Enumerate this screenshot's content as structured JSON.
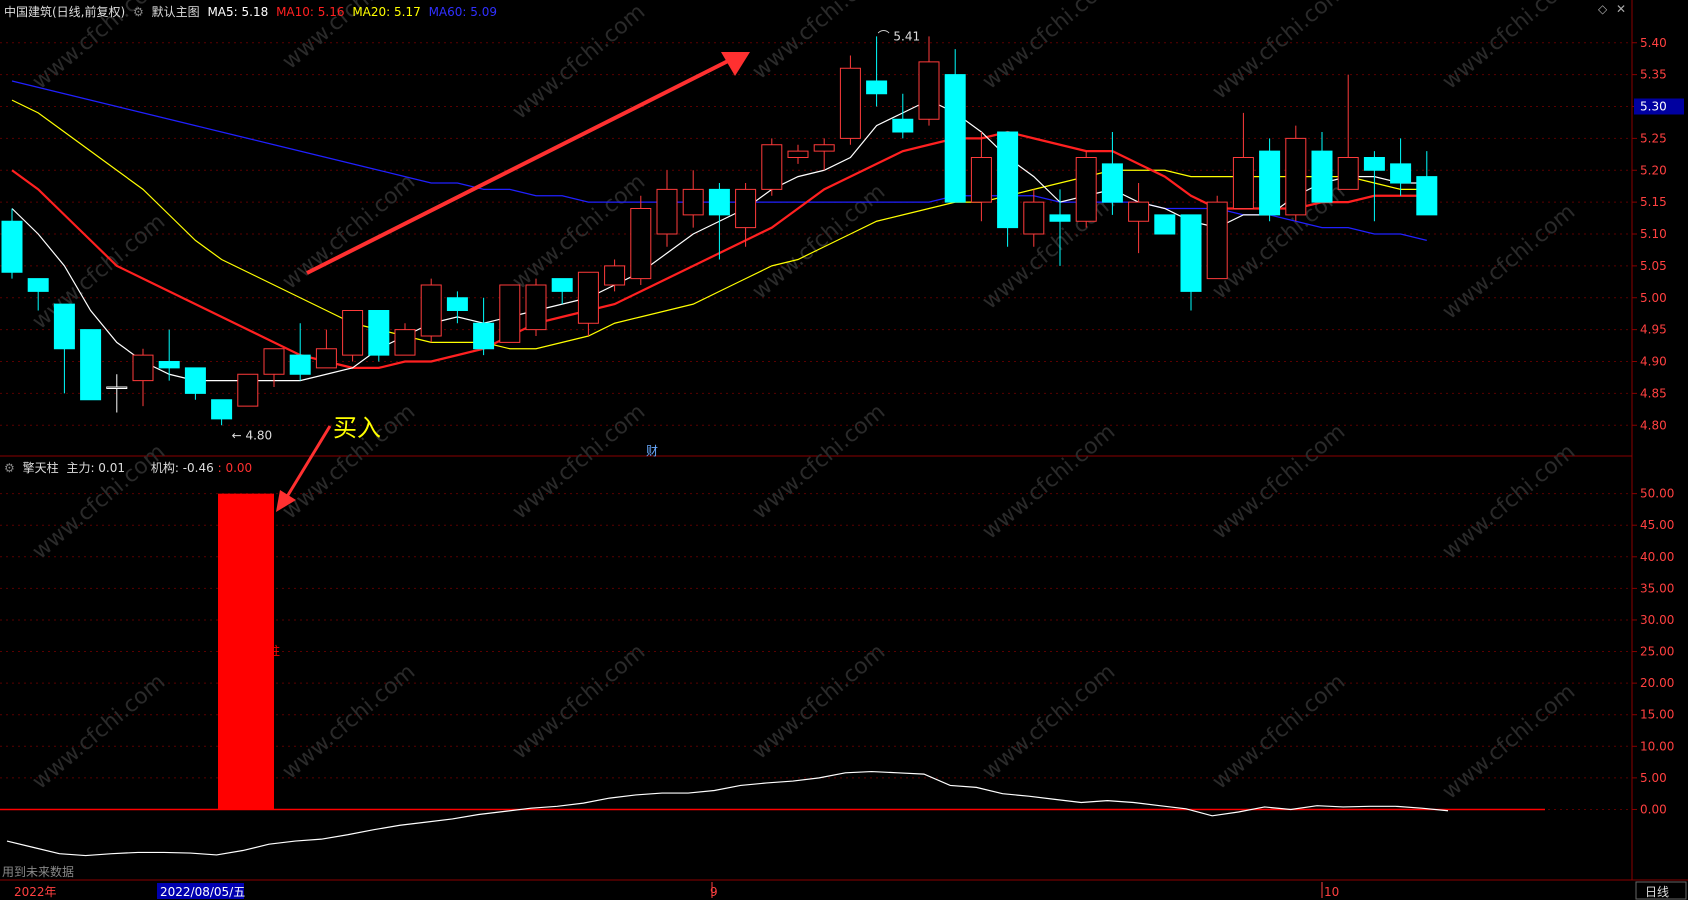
{
  "header": {
    "stock": "中国建筑(日线,前复权)",
    "template": "默认主图",
    "ma5": "MA5: 5.18",
    "ma10": "MA10: 5.16",
    "ma20": "MA20: 5.17",
    "ma60": "MA60: 5.09"
  },
  "indicator_header": {
    "name": "擎天柱",
    "main": "主力: 0.01",
    "inst": "机构: -0.46",
    "val": ": 0.00"
  },
  "toolbar": {
    "diamond": "◇",
    "x": "✕"
  },
  "annotations": {
    "buy": "买入",
    "high": "5.41",
    "low": "4.80",
    "cai": "财",
    "future": "用到未来数据",
    "pillar": "柱"
  },
  "watermark": "www.cfchi.com",
  "timeline": {
    "year": "2022年",
    "cursor_date": "2022/08/05/五",
    "m9": "9",
    "m10": "10",
    "period": "日线"
  },
  "price_axis": {
    "ticks": [
      "5.40",
      "5.35",
      "5.30",
      "5.25",
      "5.20",
      "5.15",
      "5.10",
      "5.05",
      "5.00",
      "4.95",
      "4.90",
      "4.85",
      "4.80"
    ],
    "current": "5.30"
  },
  "ind_axis": {
    "ticks": [
      "50.00",
      "45.00",
      "40.00",
      "35.00",
      "30.00",
      "25.00",
      "20.00",
      "15.00",
      "10.00",
      "5.00",
      "0.00"
    ]
  },
  "colors": {
    "up": "#ff3b3b",
    "down": "#00ffff",
    "ma5": "#ffffff",
    "ma10": "#ff2020",
    "ma20": "#ffff00",
    "ma60": "#2020ff",
    "grid": "#5a0000",
    "axis_text": "#ff4040"
  },
  "chart_data": {
    "type": "candlestick",
    "price_range": [
      4.78,
      5.42
    ],
    "ind_range": [
      -8,
      52
    ],
    "candles": [
      [
        5.12,
        5.04,
        5.14,
        5.03
      ],
      [
        5.03,
        5.01,
        5.03,
        4.98
      ],
      [
        4.99,
        4.92,
        4.99,
        4.85
      ],
      [
        4.95,
        4.84,
        4.95,
        4.84
      ],
      [
        4.86,
        4.86,
        4.88,
        4.82
      ],
      [
        4.87,
        4.91,
        4.92,
        4.83
      ],
      [
        4.9,
        4.89,
        4.95,
        4.87
      ],
      [
        4.89,
        4.85,
        4.89,
        4.84
      ],
      [
        4.84,
        4.81,
        4.84,
        4.8
      ],
      [
        4.83,
        4.88,
        4.88,
        4.83
      ],
      [
        4.88,
        4.92,
        4.92,
        4.86
      ],
      [
        4.91,
        4.88,
        4.96,
        4.87
      ],
      [
        4.89,
        4.92,
        4.95,
        4.89
      ],
      [
        4.91,
        4.98,
        4.98,
        4.9
      ],
      [
        4.98,
        4.91,
        4.98,
        4.9
      ],
      [
        4.91,
        4.95,
        4.96,
        4.91
      ],
      [
        4.94,
        5.02,
        5.03,
        4.93
      ],
      [
        5.0,
        4.98,
        5.01,
        4.96
      ],
      [
        4.96,
        4.92,
        5.0,
        4.91
      ],
      [
        4.93,
        5.02,
        5.02,
        4.93
      ],
      [
        4.95,
        5.02,
        5.03,
        4.94
      ],
      [
        5.03,
        5.01,
        5.03,
        4.99
      ],
      [
        4.96,
        5.04,
        5.04,
        4.94
      ],
      [
        5.02,
        5.05,
        5.06,
        5.01
      ],
      [
        5.03,
        5.14,
        5.16,
        5.02
      ],
      [
        5.1,
        5.17,
        5.2,
        5.08
      ],
      [
        5.13,
        5.17,
        5.2,
        5.11
      ],
      [
        5.17,
        5.13,
        5.18,
        5.06
      ],
      [
        5.11,
        5.17,
        5.18,
        5.08
      ],
      [
        5.17,
        5.24,
        5.25,
        5.16
      ],
      [
        5.22,
        5.23,
        5.24,
        5.21
      ],
      [
        5.23,
        5.24,
        5.25,
        5.2
      ],
      [
        5.25,
        5.36,
        5.38,
        5.24
      ],
      [
        5.34,
        5.32,
        5.41,
        5.3
      ],
      [
        5.28,
        5.26,
        5.32,
        5.25
      ],
      [
        5.28,
        5.37,
        5.41,
        5.27
      ],
      [
        5.35,
        5.15,
        5.39,
        5.15
      ],
      [
        5.15,
        5.22,
        5.26,
        5.12
      ],
      [
        5.26,
        5.11,
        5.26,
        5.08
      ],
      [
        5.1,
        5.15,
        5.17,
        5.08
      ],
      [
        5.13,
        5.12,
        5.17,
        5.05
      ],
      [
        5.12,
        5.22,
        5.23,
        5.11
      ],
      [
        5.21,
        5.15,
        5.26,
        5.13
      ],
      [
        5.12,
        5.15,
        5.18,
        5.07
      ],
      [
        5.13,
        5.1,
        5.13,
        5.1
      ],
      [
        5.13,
        5.01,
        5.13,
        4.98
      ],
      [
        5.03,
        5.15,
        5.16,
        5.03
      ],
      [
        5.14,
        5.22,
        5.29,
        5.14
      ],
      [
        5.23,
        5.13,
        5.25,
        5.12
      ],
      [
        5.13,
        5.25,
        5.27,
        5.12
      ],
      [
        5.23,
        5.15,
        5.26,
        5.15
      ],
      [
        5.17,
        5.22,
        5.35,
        5.17
      ],
      [
        5.22,
        5.2,
        5.23,
        5.12
      ],
      [
        5.21,
        5.18,
        5.25,
        5.16
      ],
      [
        5.19,
        5.13,
        5.23,
        5.13
      ]
    ],
    "ma5": [
      5.14,
      5.1,
      5.05,
      4.98,
      4.93,
      4.9,
      4.88,
      4.87,
      4.87,
      4.87,
      4.87,
      4.87,
      4.88,
      4.89,
      4.92,
      4.94,
      4.96,
      4.97,
      4.96,
      4.97,
      4.98,
      4.99,
      5.0,
      5.02,
      5.04,
      5.07,
      5.1,
      5.12,
      5.14,
      5.17,
      5.19,
      5.2,
      5.22,
      5.27,
      5.29,
      5.31,
      5.29,
      5.26,
      5.22,
      5.19,
      5.15,
      5.16,
      5.17,
      5.15,
      5.14,
      5.12,
      5.11,
      5.13,
      5.13,
      5.16,
      5.18,
      5.19,
      5.19,
      5.18,
      5.18
    ],
    "ma10": [
      5.2,
      5.17,
      5.13,
      5.09,
      5.05,
      5.03,
      5.01,
      4.99,
      4.97,
      4.95,
      4.93,
      4.91,
      4.9,
      4.89,
      4.89,
      4.9,
      4.9,
      4.91,
      4.92,
      4.94,
      4.96,
      4.97,
      4.98,
      4.99,
      5.01,
      5.03,
      5.05,
      5.07,
      5.09,
      5.11,
      5.14,
      5.17,
      5.19,
      5.21,
      5.23,
      5.24,
      5.25,
      5.25,
      5.26,
      5.25,
      5.24,
      5.23,
      5.23,
      5.21,
      5.19,
      5.16,
      5.14,
      5.14,
      5.14,
      5.14,
      5.15,
      5.15,
      5.16,
      5.16,
      5.16
    ],
    "ma20": [
      5.31,
      5.29,
      5.26,
      5.23,
      5.2,
      5.17,
      5.13,
      5.09,
      5.06,
      5.04,
      5.02,
      5.0,
      4.98,
      4.96,
      4.95,
      4.94,
      4.93,
      4.93,
      4.93,
      4.92,
      4.92,
      4.93,
      4.94,
      4.96,
      4.97,
      4.98,
      4.99,
      5.01,
      5.03,
      5.05,
      5.06,
      5.08,
      5.1,
      5.12,
      5.13,
      5.14,
      5.15,
      5.15,
      5.16,
      5.17,
      5.18,
      5.19,
      5.2,
      5.2,
      5.2,
      5.19,
      5.19,
      5.19,
      5.19,
      5.19,
      5.19,
      5.19,
      5.18,
      5.17,
      5.17
    ],
    "ma60": [
      5.34,
      5.33,
      5.32,
      5.31,
      5.3,
      5.29,
      5.28,
      5.27,
      5.26,
      5.25,
      5.24,
      5.23,
      5.22,
      5.21,
      5.2,
      5.19,
      5.18,
      5.18,
      5.17,
      5.17,
      5.16,
      5.16,
      5.15,
      5.15,
      5.15,
      5.15,
      5.15,
      5.15,
      5.15,
      5.15,
      5.15,
      5.15,
      5.15,
      5.15,
      5.15,
      5.15,
      5.16,
      5.16,
      5.16,
      5.16,
      5.15,
      5.15,
      5.15,
      5.15,
      5.14,
      5.14,
      5.14,
      5.13,
      5.13,
      5.12,
      5.11,
      5.11,
      5.1,
      5.1,
      5.09
    ],
    "buy_bar": {
      "index": 8,
      "value": 50
    },
    "indicator_line": [
      -5,
      -6,
      -7,
      -7.3,
      -7,
      -6.8,
      -6.8,
      -6.9,
      -7.2,
      -6.5,
      -5.5,
      -5,
      -4.7,
      -4,
      -3.2,
      -2.5,
      -2,
      -1.5,
      -0.8,
      -0.3,
      0.2,
      0.5,
      1,
      1.8,
      2.3,
      2.6,
      2.6,
      3,
      3.8,
      4.2,
      4.5,
      5,
      5.8,
      6,
      5.8,
      5.6,
      3.8,
      3.5,
      2.5,
      2.1,
      1.6,
      1.1,
      1.4,
      1.1,
      0.6,
      0.1,
      -1,
      -0.4,
      0.4,
      0,
      0.6,
      0.4,
      0.5,
      0.5,
      0.2,
      -0.2
    ]
  }
}
